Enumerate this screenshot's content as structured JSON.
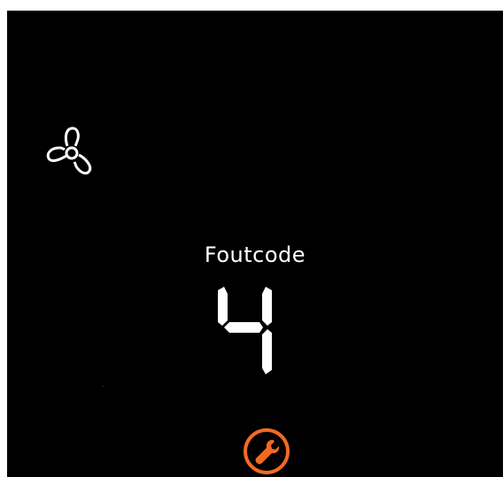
{
  "display": {
    "label": "Foutcode",
    "error_code": "4"
  },
  "icons": {
    "fan": "fan-icon",
    "service": "wrench-icon"
  },
  "colors": {
    "background": "#000000",
    "foreground": "#ffffff",
    "accent": "#f26a21"
  }
}
